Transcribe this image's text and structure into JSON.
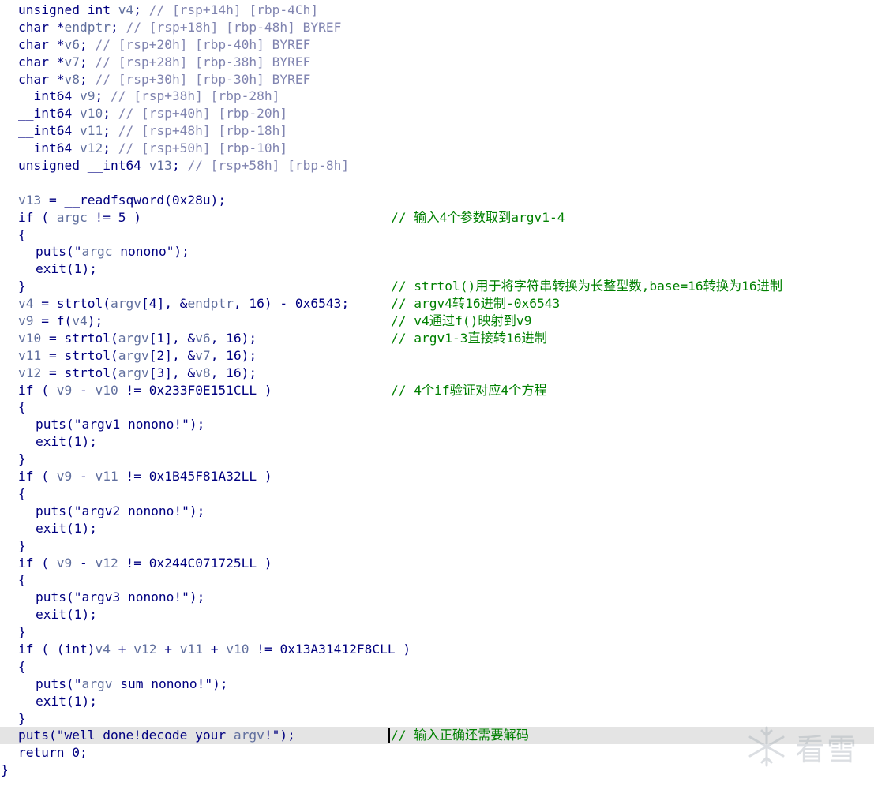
{
  "code_lines": [
    {
      "indent": 1,
      "text": "unsigned int v4; ",
      "comment": "",
      "var_comment": "// [rsp+14h] [rbp-4Ch]"
    },
    {
      "indent": 1,
      "text": "char *endptr; ",
      "comment": "",
      "var_comment": "// [rsp+18h] [rbp-48h] BYREF"
    },
    {
      "indent": 1,
      "text": "char *v6; ",
      "comment": "",
      "var_comment": "// [rsp+20h] [rbp-40h] BYREF"
    },
    {
      "indent": 1,
      "text": "char *v7; ",
      "comment": "",
      "var_comment": "// [rsp+28h] [rbp-38h] BYREF"
    },
    {
      "indent": 1,
      "text": "char *v8; ",
      "comment": "",
      "var_comment": "// [rsp+30h] [rbp-30h] BYREF"
    },
    {
      "indent": 1,
      "text": "__int64 v9; ",
      "comment": "",
      "var_comment": "// [rsp+38h] [rbp-28h]"
    },
    {
      "indent": 1,
      "text": "__int64 v10; ",
      "comment": "",
      "var_comment": "// [rsp+40h] [rbp-20h]"
    },
    {
      "indent": 1,
      "text": "__int64 v11; ",
      "comment": "",
      "var_comment": "// [rsp+48h] [rbp-18h]"
    },
    {
      "indent": 1,
      "text": "__int64 v12; ",
      "comment": "",
      "var_comment": "// [rsp+50h] [rbp-10h]"
    },
    {
      "indent": 1,
      "text": "unsigned __int64 v13; ",
      "comment": "",
      "var_comment": "// [rsp+58h] [rbp-8h]"
    },
    {
      "indent": 0,
      "text": "",
      "comment": "",
      "var_comment": ""
    },
    {
      "indent": 1,
      "text": "v13 = __readfsqword(0x28u);",
      "comment": "",
      "var_comment": ""
    },
    {
      "indent": 1,
      "text": "if ( argc != 5 )",
      "comment": "// 输入4个参数取到argv1-4",
      "var_comment": ""
    },
    {
      "indent": 1,
      "text": "{",
      "comment": "",
      "var_comment": ""
    },
    {
      "indent": 2,
      "text": "puts(\"argc nonono\");",
      "comment": "",
      "var_comment": ""
    },
    {
      "indent": 2,
      "text": "exit(1);",
      "comment": "",
      "var_comment": ""
    },
    {
      "indent": 1,
      "text": "}",
      "comment": "// strtol()用于将字符串转换为长整型数,base=16转换为16进制",
      "var_comment": ""
    },
    {
      "indent": 1,
      "text": "v4 = strtol(argv[4], &endptr, 16) - 0x6543;",
      "comment": "// argv4转16进制-0x6543",
      "var_comment": ""
    },
    {
      "indent": 1,
      "text": "v9 = f(v4);",
      "comment": "// v4通过f()映射到v9",
      "var_comment": ""
    },
    {
      "indent": 1,
      "text": "v10 = strtol(argv[1], &v6, 16);",
      "comment": "// argv1-3直接转16进制",
      "var_comment": ""
    },
    {
      "indent": 1,
      "text": "v11 = strtol(argv[2], &v7, 16);",
      "comment": "",
      "var_comment": ""
    },
    {
      "indent": 1,
      "text": "v12 = strtol(argv[3], &v8, 16);",
      "comment": "",
      "var_comment": ""
    },
    {
      "indent": 1,
      "text": "if ( v9 - v10 != 0x233F0E151CLL )",
      "comment": "// 4个if验证对应4个方程",
      "var_comment": ""
    },
    {
      "indent": 1,
      "text": "{",
      "comment": "",
      "var_comment": ""
    },
    {
      "indent": 2,
      "text": "puts(\"argv1 nonono!\");",
      "comment": "",
      "var_comment": ""
    },
    {
      "indent": 2,
      "text": "exit(1);",
      "comment": "",
      "var_comment": ""
    },
    {
      "indent": 1,
      "text": "}",
      "comment": "",
      "var_comment": ""
    },
    {
      "indent": 1,
      "text": "if ( v9 - v11 != 0x1B45F81A32LL )",
      "comment": "",
      "var_comment": ""
    },
    {
      "indent": 1,
      "text": "{",
      "comment": "",
      "var_comment": ""
    },
    {
      "indent": 2,
      "text": "puts(\"argv2 nonono!\");",
      "comment": "",
      "var_comment": ""
    },
    {
      "indent": 2,
      "text": "exit(1);",
      "comment": "",
      "var_comment": ""
    },
    {
      "indent": 1,
      "text": "}",
      "comment": "",
      "var_comment": ""
    },
    {
      "indent": 1,
      "text": "if ( v9 - v12 != 0x244C071725LL )",
      "comment": "",
      "var_comment": ""
    },
    {
      "indent": 1,
      "text": "{",
      "comment": "",
      "var_comment": ""
    },
    {
      "indent": 2,
      "text": "puts(\"argv3 nonono!\");",
      "comment": "",
      "var_comment": ""
    },
    {
      "indent": 2,
      "text": "exit(1);",
      "comment": "",
      "var_comment": ""
    },
    {
      "indent": 1,
      "text": "}",
      "comment": "",
      "var_comment": ""
    },
    {
      "indent": 1,
      "text": "if ( (int)v4 + v12 + v11 + v10 != 0x13A31412F8CLL )",
      "comment": "",
      "var_comment": ""
    },
    {
      "indent": 1,
      "text": "{",
      "comment": "",
      "var_comment": ""
    },
    {
      "indent": 2,
      "text": "puts(\"argv sum nonono!\");",
      "comment": "",
      "var_comment": ""
    },
    {
      "indent": 2,
      "text": "exit(1);",
      "comment": "",
      "var_comment": ""
    },
    {
      "indent": 1,
      "text": "}",
      "comment": "",
      "var_comment": ""
    },
    {
      "indent": 1,
      "text": "puts(\"well done!decode your argv!\");",
      "comment": "// 输入正确还需要解码",
      "var_comment": ""
    },
    {
      "indent": 1,
      "text": "return 0;",
      "comment": "",
      "var_comment": ""
    },
    {
      "indent": 0,
      "text": "}",
      "comment": "",
      "var_comment": ""
    }
  ],
  "highlighted_line": 42,
  "watermark": {
    "text": "看雪",
    "icon": "snowflake-logo-icon"
  },
  "colors": {
    "keyword": "#000080",
    "variable": "#606f9e",
    "comment": "#008000",
    "highlight": "#e4e4e4"
  }
}
